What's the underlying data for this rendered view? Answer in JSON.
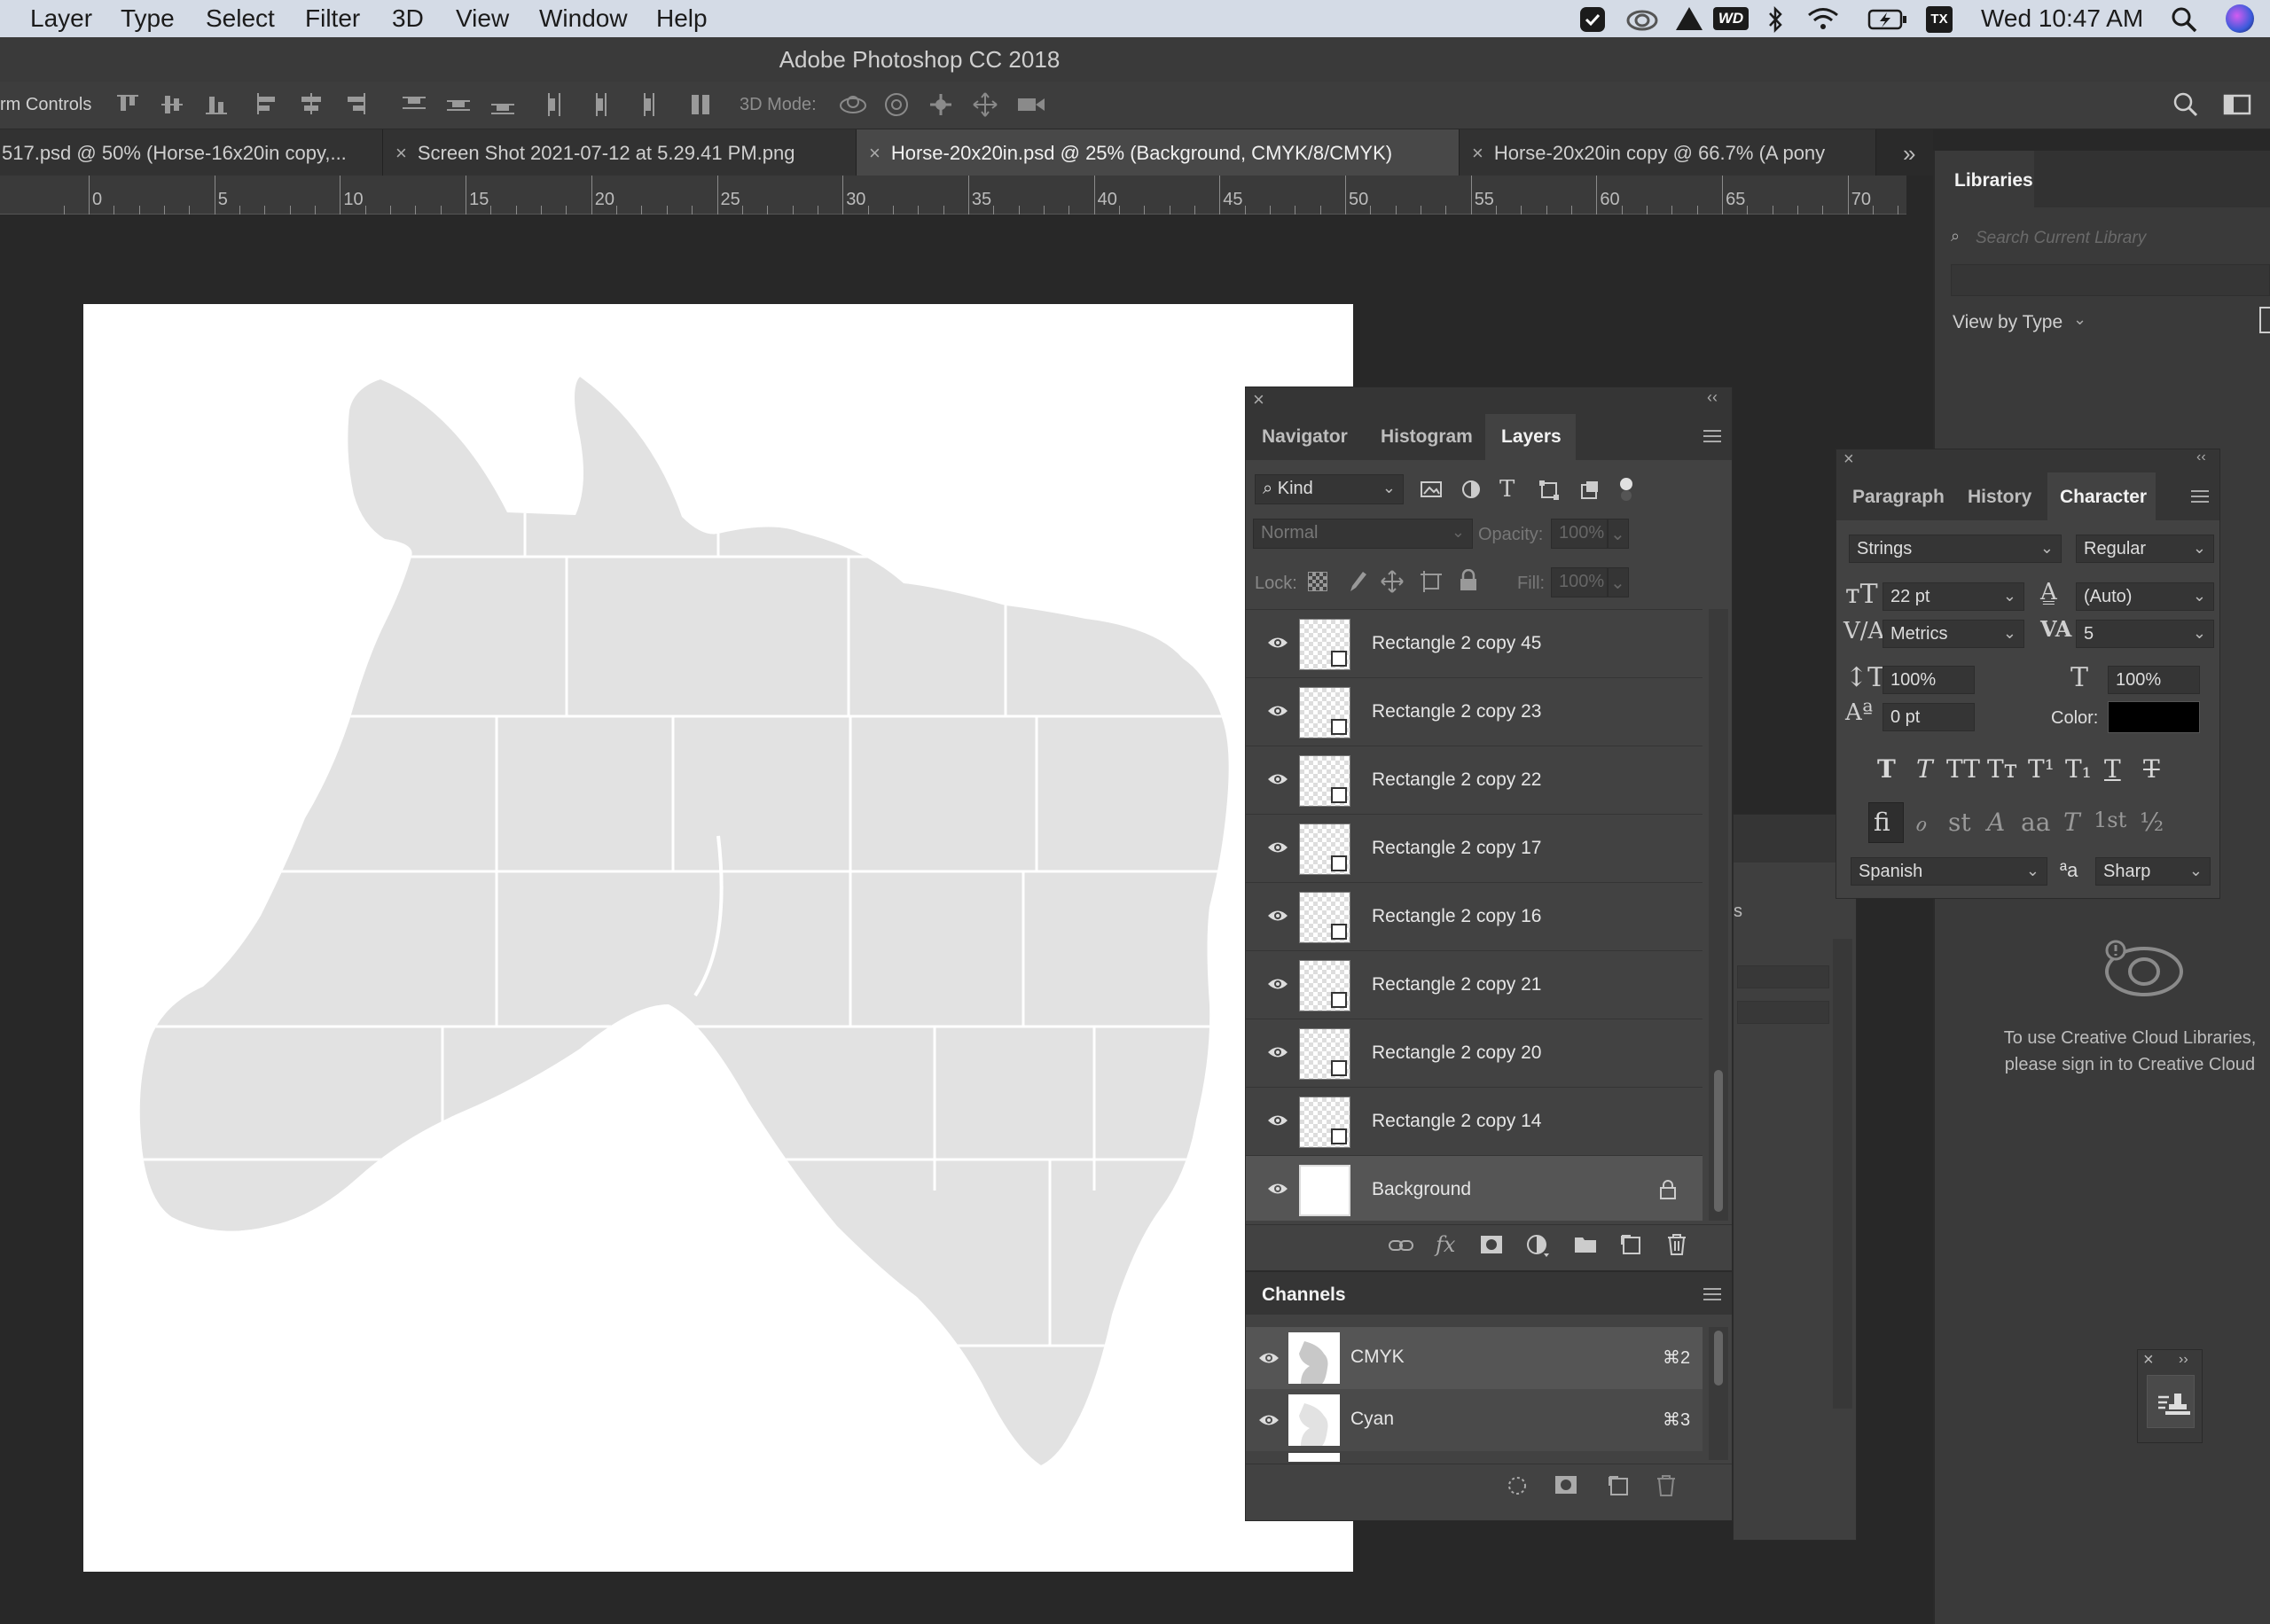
{
  "menubar": {
    "items": [
      "Layer",
      "Type",
      "Select",
      "Filter",
      "3D",
      "View",
      "Window",
      "Help"
    ],
    "clock": "Wed 10:47 AM",
    "status_icons": [
      "checkmark-icon",
      "creative-cloud-icon",
      "drive-icon",
      "wd-icon",
      "bluetooth-icon",
      "wifi-icon",
      "battery-icon",
      "tx-icon",
      "spotlight-icon",
      "siri-icon"
    ]
  },
  "app": {
    "title": "Adobe Photoshop CC 2018"
  },
  "options": {
    "transform_label": "rm Controls",
    "mode_label": "3D Mode:"
  },
  "tabs": [
    {
      "label": "517.psd @ 50% (Horse-16x20in copy,..."
    },
    {
      "label": "Screen Shot 2021-07-12 at 5.29.41 PM.png"
    },
    {
      "label": "Horse-20x20in.psd @ 25% (Background, CMYK/8/CMYK)"
    },
    {
      "label": "Horse-20x20in copy @ 66.7% (A pony"
    }
  ],
  "tabs_overflow": "»",
  "ruler": {
    "labels": [
      "0",
      "5",
      "10",
      "15",
      "20",
      "25",
      "30",
      "35",
      "40",
      "45",
      "50",
      "55",
      "60",
      "65",
      "70"
    ]
  },
  "layers_panel": {
    "tabs": [
      "Navigator",
      "Histogram",
      "Layers"
    ],
    "active_tab": "Layers",
    "filter_kind": "Kind",
    "blend_mode": "Normal",
    "opacity_label": "Opacity:",
    "opacity_value": "100%",
    "lock_label": "Lock:",
    "fill_label": "Fill:",
    "fill_value": "100%",
    "layers": [
      {
        "name": "Rectangle 2 copy 45"
      },
      {
        "name": "Rectangle 2 copy 23"
      },
      {
        "name": "Rectangle 2 copy 22"
      },
      {
        "name": "Rectangle 2 copy 17"
      },
      {
        "name": "Rectangle 2 copy 16"
      },
      {
        "name": "Rectangle 2 copy 21"
      },
      {
        "name": "Rectangle 2 copy 20"
      },
      {
        "name": "Rectangle 2 copy 14"
      },
      {
        "name": "Background",
        "locked": true
      }
    ]
  },
  "channels_panel": {
    "title": "Channels",
    "channels": [
      {
        "name": "CMYK",
        "shortcut": "⌘2"
      },
      {
        "name": "Cyan",
        "shortcut": "⌘3"
      }
    ]
  },
  "character_panel": {
    "tabs": [
      "Paragraph",
      "History",
      "Character"
    ],
    "active_tab": "Character",
    "font_family": "Strings",
    "font_style": "Regular",
    "font_size": "22 pt",
    "leading": "(Auto)",
    "kerning": "Metrics",
    "tracking": "5",
    "vertical_scale": "100%",
    "horizontal_scale": "100%",
    "baseline_shift": "0 pt",
    "color_label": "Color:",
    "color_value": "#000000",
    "language": "Spanish",
    "aa_label": "ªa",
    "antialias": "Sharp",
    "style_buttons": [
      "T",
      "T",
      "TT",
      "Tт",
      "T¹",
      "T₁",
      "T",
      "T"
    ],
    "opentype_buttons": [
      "ﬁ",
      "ℴ",
      "st",
      "A",
      "aa",
      "T",
      "1st",
      "½"
    ]
  },
  "libraries_panel": {
    "title": "Libraries",
    "search_placeholder": "Search Current Library",
    "view_by": "View by Type",
    "message_line1": "To use Creative Cloud Libraries,",
    "message_line2": "please sign in to Creative Cloud"
  },
  "colors": {
    "canvas_shape": "#e2e2e2",
    "page": "#ffffff",
    "workspace": "#282828",
    "panel": "#424242"
  }
}
